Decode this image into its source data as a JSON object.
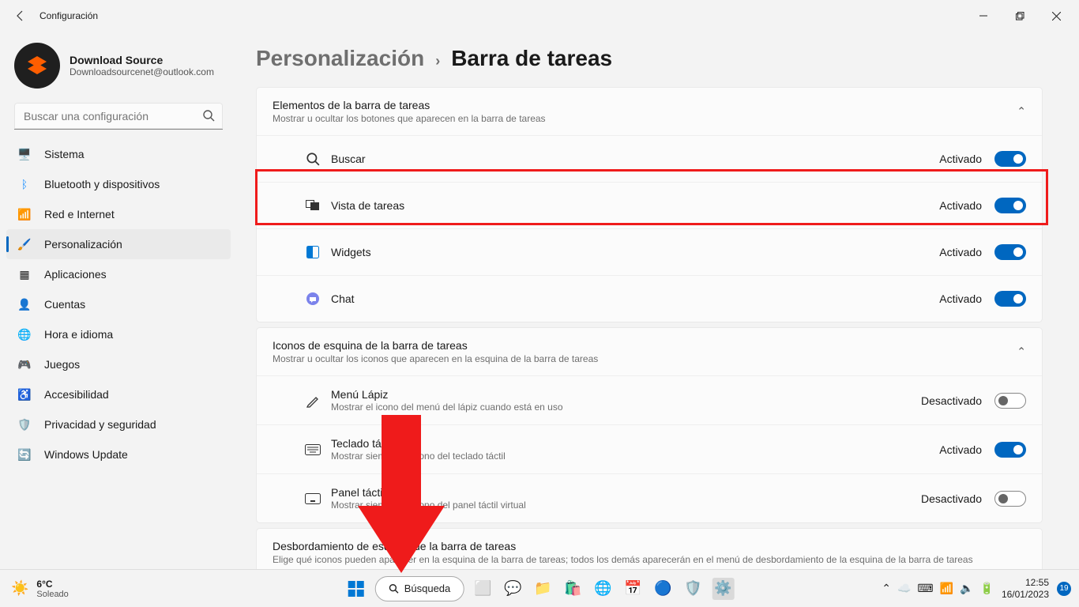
{
  "titlebar": {
    "title": "Configuración"
  },
  "profile": {
    "name": "Download Source",
    "email": "Downloadsourcenet@outlook.com"
  },
  "search": {
    "placeholder": "Buscar una configuración"
  },
  "nav": [
    {
      "label": "Sistema",
      "icon": "🖥️"
    },
    {
      "label": "Bluetooth y dispositivos",
      "icon": "ᛒ",
      "iconColor": "#1e90ff"
    },
    {
      "label": "Red e Internet",
      "icon": "📶",
      "iconColor": "#1e90ff"
    },
    {
      "label": "Personalización",
      "icon": "🖌️",
      "active": true
    },
    {
      "label": "Aplicaciones",
      "icon": "▦"
    },
    {
      "label": "Cuentas",
      "icon": "👤",
      "iconColor": "#1ea565"
    },
    {
      "label": "Hora e idioma",
      "icon": "🌐",
      "iconColor": "#0aa59a"
    },
    {
      "label": "Juegos",
      "icon": "🎮"
    },
    {
      "label": "Accesibilidad",
      "icon": "♿",
      "iconColor": "#3466c4"
    },
    {
      "label": "Privacidad y seguridad",
      "icon": "🛡️",
      "iconColor": "#888"
    },
    {
      "label": "Windows Update",
      "icon": "🔄",
      "iconColor": "#d47a1f"
    }
  ],
  "breadcrumb": {
    "parent": "Personalización",
    "current": "Barra de tareas",
    "separator": "›"
  },
  "section1": {
    "title": "Elementos de la barra de tareas",
    "subtitle": "Mostrar u ocultar los botones que aparecen en la barra de tareas",
    "rows": [
      {
        "label": "Buscar",
        "state": "Activado",
        "on": true
      },
      {
        "label": "Vista de tareas",
        "state": "Activado",
        "on": true
      },
      {
        "label": "Widgets",
        "state": "Activado",
        "on": true
      },
      {
        "label": "Chat",
        "state": "Activado",
        "on": true
      }
    ]
  },
  "section2": {
    "title": "Iconos de esquina de la barra de tareas",
    "subtitle": "Mostrar u ocultar los iconos que aparecen en la esquina de la barra de tareas",
    "rows": [
      {
        "label": "Menú Lápiz",
        "sub": "Mostrar el icono del menú del lápiz cuando está en uso",
        "state": "Desactivado",
        "on": false
      },
      {
        "label": "Teclado táctil",
        "sub": "Mostrar siempre el icono del teclado táctil",
        "state": "Activado",
        "on": true
      },
      {
        "label": "Panel táctil",
        "sub": "Mostrar siempre el icono del panel táctil virtual",
        "state": "Desactivado",
        "on": false
      }
    ]
  },
  "section3": {
    "title": "Desbordamiento de esquina de la barra de tareas",
    "subtitle": "Elige qué iconos pueden aparecer en la esquina de la barra de tareas; todos los demás aparecerán en el menú de desbordamiento de la esquina de la barra de tareas"
  },
  "taskbar": {
    "weather": {
      "temp": "6°C",
      "cond": "Soleado"
    },
    "search": "Búsqueda",
    "time": "12:55",
    "date": "16/01/2023",
    "notif_count": "19"
  }
}
